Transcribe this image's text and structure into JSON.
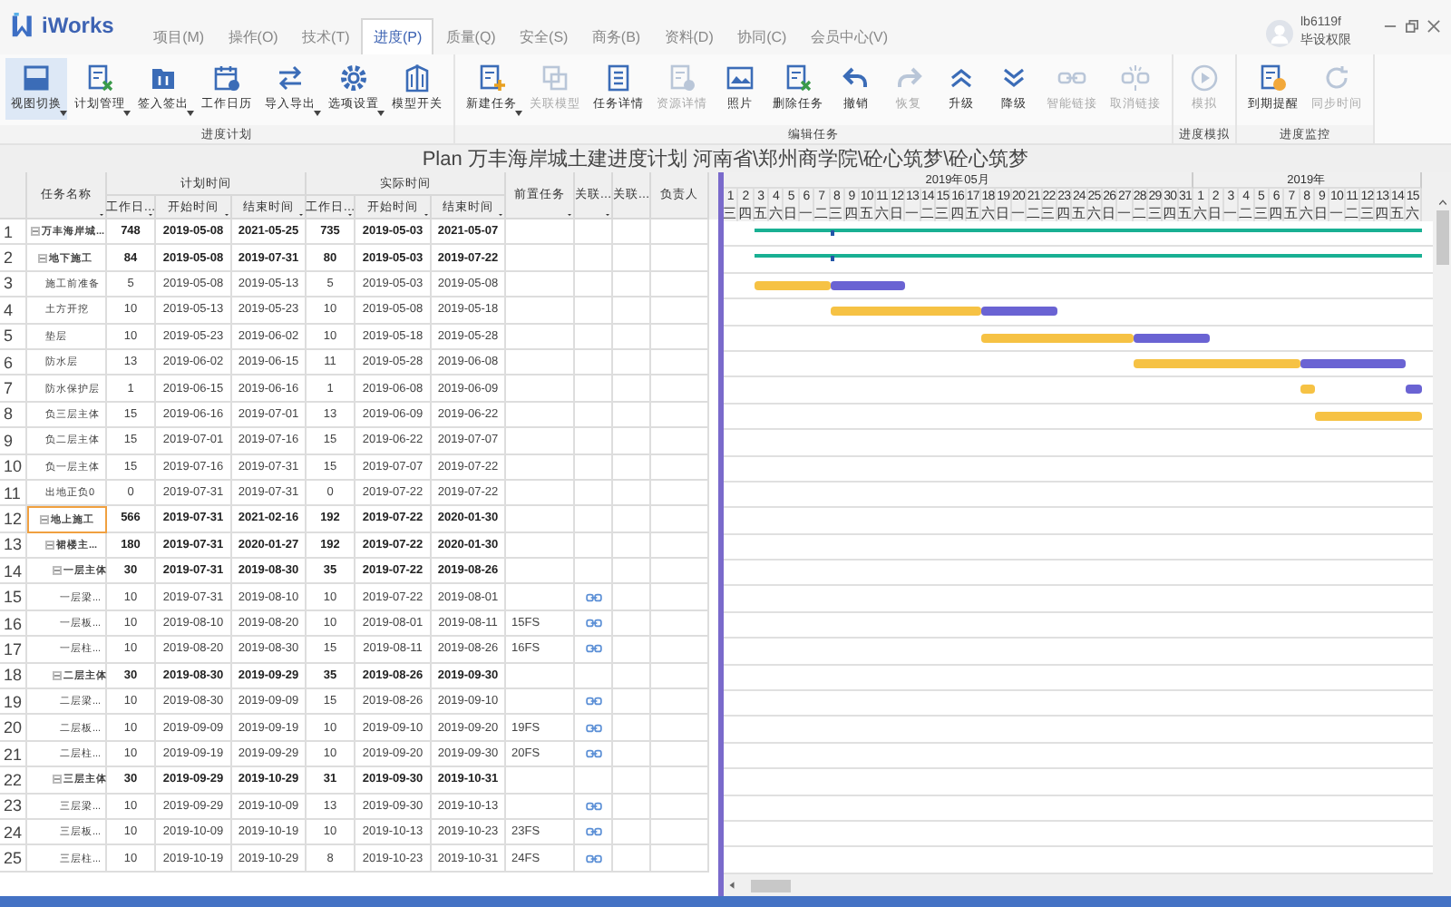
{
  "app": {
    "name": "iWorks"
  },
  "menu_tabs": [
    {
      "label": "项目(M)",
      "selected": false
    },
    {
      "label": "操作(O)",
      "selected": false
    },
    {
      "label": "技术(T)",
      "selected": false
    },
    {
      "label": "进度(P)",
      "selected": true
    },
    {
      "label": "质量(Q)",
      "selected": false
    },
    {
      "label": "安全(S)",
      "selected": false
    },
    {
      "label": "商务(B)",
      "selected": false
    },
    {
      "label": "资料(D)",
      "selected": false
    },
    {
      "label": "协同(C)",
      "selected": false
    },
    {
      "label": "会员中心(V)",
      "selected": false
    }
  ],
  "user": {
    "name": "lb6119f",
    "role": "毕设权限"
  },
  "ribbon_groups": [
    {
      "label": "进度计划",
      "buttons": [
        {
          "label": "视图切换",
          "selected": true,
          "disabled": false,
          "dropdown": true
        },
        {
          "label": "计划管理",
          "selected": false,
          "disabled": false,
          "dropdown": true
        },
        {
          "label": "签入签出",
          "selected": false,
          "disabled": false,
          "dropdown": true
        },
        {
          "label": "工作日历",
          "selected": false,
          "disabled": false,
          "dropdown": false
        },
        {
          "label": "导入导出",
          "selected": false,
          "disabled": false,
          "dropdown": true
        },
        {
          "label": "选项设置",
          "selected": false,
          "disabled": false,
          "dropdown": true
        },
        {
          "label": "模型开关",
          "selected": false,
          "disabled": false,
          "dropdown": false
        }
      ]
    },
    {
      "label": "编辑任务",
      "buttons": [
        {
          "label": "新建任务",
          "selected": false,
          "disabled": false,
          "dropdown": true
        },
        {
          "label": "关联模型",
          "selected": false,
          "disabled": true,
          "dropdown": false
        },
        {
          "label": "任务详情",
          "selected": false,
          "disabled": false,
          "dropdown": false
        },
        {
          "label": "资源详情",
          "selected": false,
          "disabled": true,
          "dropdown": false
        },
        {
          "label": "照片",
          "selected": false,
          "disabled": false,
          "dropdown": false
        },
        {
          "label": "删除任务",
          "selected": false,
          "disabled": false,
          "dropdown": false
        },
        {
          "label": "撤销",
          "selected": false,
          "disabled": false,
          "dropdown": false
        },
        {
          "label": "恢复",
          "selected": false,
          "disabled": true,
          "dropdown": false
        },
        {
          "label": "升级",
          "selected": false,
          "disabled": false,
          "dropdown": false
        },
        {
          "label": "降级",
          "selected": false,
          "disabled": false,
          "dropdown": false
        },
        {
          "label": "智能链接",
          "selected": false,
          "disabled": true,
          "dropdown": false
        },
        {
          "label": "取消链接",
          "selected": false,
          "disabled": true,
          "dropdown": false
        }
      ]
    },
    {
      "label": "进度模拟",
      "buttons": [
        {
          "label": "模拟",
          "selected": false,
          "disabled": true,
          "dropdown": false
        }
      ]
    },
    {
      "label": "进度监控",
      "buttons": [
        {
          "label": "到期提醒",
          "selected": false,
          "disabled": false,
          "dropdown": false
        },
        {
          "label": "同步时间",
          "selected": false,
          "disabled": true,
          "dropdown": false
        }
      ]
    }
  ],
  "plan_title": "Plan 万丰海岸城土建进度计划 河南省\\郑州商学院\\砼心筑梦\\砼心筑梦",
  "table": {
    "columns": [
      {
        "label": "任务名称",
        "filter": true
      },
      {
        "group": "计划时间",
        "columns": [
          {
            "label": "工作日…",
            "filter": true
          },
          {
            "label": "开始时间",
            "filter": true
          },
          {
            "label": "结束时间",
            "filter": true
          }
        ]
      },
      {
        "group": "实际时间",
        "columns": [
          {
            "label": "工作日…",
            "filter": true
          },
          {
            "label": "开始时间",
            "filter": true
          },
          {
            "label": "结束时间",
            "filter": true
          }
        ]
      },
      {
        "label": "前置任务",
        "filter": true
      },
      {
        "label": "关联…",
        "filter": true
      },
      {
        "label": "关联…",
        "filter": false
      },
      {
        "label": "负责人",
        "filter": false
      }
    ],
    "rows": [
      {
        "number": "1",
        "name": "万丰海岸城...",
        "plan_days": "748",
        "plan_start": "2019-05-08",
        "plan_end": "2021-05-25",
        "actual_days": "735",
        "actual_start": "2019-05-03",
        "actual_end": "2021-05-07",
        "linked": false,
        "selected": false,
        "expanded": true,
        "children": [
          {
            "number": "2",
            "name": "地下施工",
            "plan_days": "84",
            "plan_start": "2019-05-08",
            "plan_end": "2019-07-31",
            "actual_days": "80",
            "actual_start": "2019-05-03",
            "actual_end": "2019-07-22",
            "linked": false,
            "selected": false,
            "expanded": true,
            "children": [
              {
                "number": "3",
                "name": "施工前准备",
                "plan_days": "5",
                "plan_start": "2019-05-08",
                "plan_end": "2019-05-13",
                "actual_days": "5",
                "actual_start": "2019-05-03",
                "actual_end": "2019-05-08",
                "linked": false,
                "selected": false
              },
              {
                "number": "4",
                "name": "土方开挖",
                "plan_days": "10",
                "plan_start": "2019-05-13",
                "plan_end": "2019-05-23",
                "actual_days": "10",
                "actual_start": "2019-05-08",
                "actual_end": "2019-05-18",
                "linked": false,
                "selected": false
              },
              {
                "number": "5",
                "name": "垫层",
                "plan_days": "10",
                "plan_start": "2019-05-23",
                "plan_end": "2019-06-02",
                "actual_days": "10",
                "actual_start": "2019-05-18",
                "actual_end": "2019-05-28",
                "linked": false,
                "selected": false
              },
              {
                "number": "6",
                "name": "防水层",
                "plan_days": "13",
                "plan_start": "2019-06-02",
                "plan_end": "2019-06-15",
                "actual_days": "11",
                "actual_start": "2019-05-28",
                "actual_end": "2019-06-08",
                "linked": false,
                "selected": false
              },
              {
                "number": "7",
                "name": "防水保护层",
                "plan_days": "1",
                "plan_start": "2019-06-15",
                "plan_end": "2019-06-16",
                "actual_days": "1",
                "actual_start": "2019-06-08",
                "actual_end": "2019-06-09",
                "linked": false,
                "selected": false
              },
              {
                "number": "8",
                "name": "负三层主体",
                "plan_days": "15",
                "plan_start": "2019-06-16",
                "plan_end": "2019-07-01",
                "actual_days": "13",
                "actual_start": "2019-06-09",
                "actual_end": "2019-06-22",
                "linked": false,
                "selected": false
              },
              {
                "number": "9",
                "name": "负二层主体",
                "plan_days": "15",
                "plan_start": "2019-07-01",
                "plan_end": "2019-07-16",
                "actual_days": "15",
                "actual_start": "2019-06-22",
                "actual_end": "2019-07-07",
                "linked": false,
                "selected": false
              },
              {
                "number": "10",
                "name": "负一层主体",
                "plan_days": "15",
                "plan_start": "2019-07-16",
                "plan_end": "2019-07-31",
                "actual_days": "15",
                "actual_start": "2019-07-07",
                "actual_end": "2019-07-22",
                "linked": false,
                "selected": false
              },
              {
                "number": "11",
                "name": "出地正负0",
                "plan_days": "0",
                "plan_start": "2019-07-31",
                "plan_end": "2019-07-31",
                "actual_days": "0",
                "actual_start": "2019-07-22",
                "actual_end": "2019-07-22",
                "linked": false,
                "selected": false
              }
            ]
          },
          {
            "number": "12",
            "name": "地上施工",
            "plan_days": "566",
            "plan_start": "2019-07-31",
            "plan_end": "2021-02-16",
            "actual_days": "192",
            "actual_start": "2019-07-22",
            "actual_end": "2020-01-30",
            "linked": false,
            "selected": true,
            "expanded": true,
            "children": [
              {
                "number": "13",
                "name": "裙楼主...",
                "plan_days": "180",
                "plan_start": "2019-07-31",
                "plan_end": "2020-01-27",
                "actual_days": "192",
                "actual_start": "2019-07-22",
                "actual_end": "2020-01-30",
                "linked": false,
                "selected": false,
                "expanded": true,
                "children": [
                  {
                    "number": "14",
                    "name": "一层主体",
                    "plan_days": "30",
                    "plan_start": "2019-07-31",
                    "plan_end": "2019-08-30",
                    "actual_days": "35",
                    "actual_start": "2019-07-22",
                    "actual_end": "2019-08-26",
                    "linked": false,
                    "selected": false,
                    "expanded": true,
                    "children": [
                      {
                        "number": "15",
                        "name": "一层梁...",
                        "plan_days": "10",
                        "plan_start": "2019-07-31",
                        "plan_end": "2019-08-10",
                        "actual_days": "10",
                        "actual_start": "2019-07-22",
                        "actual_end": "2019-08-01",
                        "linked": true,
                        "selected": false
                      },
                      {
                        "number": "16",
                        "name": "一层板...",
                        "plan_days": "10",
                        "plan_start": "2019-08-10",
                        "plan_end": "2019-08-20",
                        "actual_days": "10",
                        "actual_start": "2019-08-01",
                        "actual_end": "2019-08-11",
                        "predecessor": "15FS",
                        "linked": true,
                        "selected": false
                      },
                      {
                        "number": "17",
                        "name": "一层柱...",
                        "plan_days": "10",
                        "plan_start": "2019-08-20",
                        "plan_end": "2019-08-30",
                        "actual_days": "15",
                        "actual_start": "2019-08-11",
                        "actual_end": "2019-08-26",
                        "predecessor": "16FS",
                        "linked": true,
                        "selected": false
                      }
                    ]
                  },
                  {
                    "number": "18",
                    "name": "二层主体",
                    "plan_days": "30",
                    "plan_start": "2019-08-30",
                    "plan_end": "2019-09-29",
                    "actual_days": "35",
                    "actual_start": "2019-08-26",
                    "actual_end": "2019-09-30",
                    "linked": false,
                    "selected": false,
                    "expanded": true,
                    "children": [
                      {
                        "number": "19",
                        "name": "二层梁...",
                        "plan_days": "10",
                        "plan_start": "2019-08-30",
                        "plan_end": "2019-09-09",
                        "actual_days": "15",
                        "actual_start": "2019-08-26",
                        "actual_end": "2019-09-10",
                        "linked": true,
                        "selected": false
                      },
                      {
                        "number": "20",
                        "name": "二层板...",
                        "plan_days": "10",
                        "plan_start": "2019-09-09",
                        "plan_end": "2019-09-19",
                        "actual_days": "10",
                        "actual_start": "2019-09-10",
                        "actual_end": "2019-09-20",
                        "predecessor": "19FS",
                        "linked": true,
                        "selected": false
                      },
                      {
                        "number": "21",
                        "name": "二层柱...",
                        "plan_days": "10",
                        "plan_start": "2019-09-19",
                        "plan_end": "2019-09-29",
                        "actual_days": "10",
                        "actual_start": "2019-09-20",
                        "actual_end": "2019-09-30",
                        "predecessor": "20FS",
                        "linked": true,
                        "selected": false
                      }
                    ]
                  },
                  {
                    "number": "22",
                    "name": "三层主体",
                    "plan_days": "30",
                    "plan_start": "2019-09-29",
                    "plan_end": "2019-10-29",
                    "actual_days": "31",
                    "actual_start": "2019-09-30",
                    "actual_end": "2019-10-31",
                    "linked": false,
                    "selected": false,
                    "expanded": true,
                    "children": [
                      {
                        "number": "23",
                        "name": "三层梁...",
                        "plan_days": "10",
                        "plan_start": "2019-09-29",
                        "plan_end": "2019-10-09",
                        "actual_days": "13",
                        "actual_start": "2019-09-30",
                        "actual_end": "2019-10-13",
                        "linked": true,
                        "selected": false
                      },
                      {
                        "number": "24",
                        "name": "三层板...",
                        "plan_days": "10",
                        "plan_start": "2019-10-09",
                        "plan_end": "2019-10-19",
                        "actual_days": "10",
                        "actual_start": "2019-10-13",
                        "actual_end": "2019-10-23",
                        "predecessor": "23FS",
                        "linked": true,
                        "selected": false
                      },
                      {
                        "number": "25",
                        "name": "三层柱...",
                        "plan_days": "10",
                        "plan_start": "2019-10-19",
                        "plan_end": "2019-10-29",
                        "actual_days": "8",
                        "actual_start": "2019-10-23",
                        "actual_end": "2019-10-31",
                        "predecessor": "24FS",
                        "linked": true,
                        "selected": false
                      }
                    ]
                  }
                ]
              }
            ]
          }
        ]
      }
    ]
  },
  "gantt": {
    "months": [
      {
        "label": "2019年05月",
        "days": [
          "1",
          "2",
          "3",
          "4",
          "5",
          "6",
          "7",
          "8",
          "9",
          "10",
          "11",
          "12",
          "13",
          "14",
          "15",
          "16",
          "17",
          "18",
          "19",
          "20",
          "21",
          "22",
          "23",
          "24",
          "25",
          "26",
          "27",
          "28",
          "29",
          "30",
          "31"
        ],
        "weekdays": [
          "三",
          "四",
          "五",
          "六",
          "日",
          "一",
          "二",
          "三",
          "四",
          "五",
          "六",
          "日",
          "一",
          "二",
          "三",
          "四",
          "五",
          "六",
          "日",
          "一",
          "二",
          "三",
          "四",
          "五",
          "六",
          "日",
          "一",
          "二",
          "三",
          "四",
          "五"
        ]
      },
      {
        "label": "2019年",
        "days": [
          "1",
          "2",
          "3",
          "4",
          "5",
          "6",
          "7",
          "8",
          "9",
          "10",
          "11",
          "12",
          "13",
          "14",
          "15"
        ],
        "weekdays": [
          "六",
          "日",
          "一",
          "二",
          "三",
          "四",
          "五",
          "六",
          "日",
          "一",
          "二",
          "三",
          "四",
          "五",
          "六"
        ]
      }
    ]
  }
}
